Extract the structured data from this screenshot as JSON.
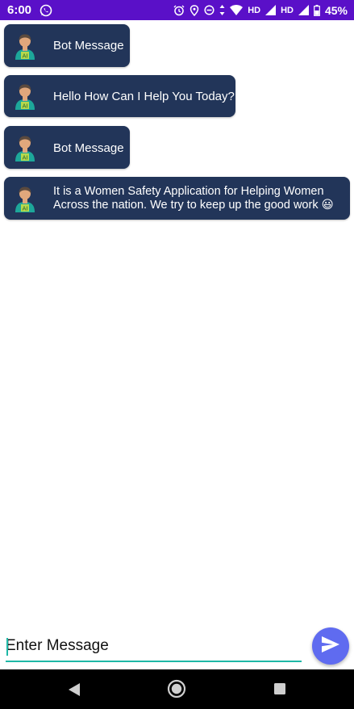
{
  "status_bar": {
    "time": "6:00",
    "network_label_1": "HD",
    "network_label_2": "HD",
    "battery": "45%",
    "icons": [
      "whatsapp-icon",
      "alarm-icon",
      "location-icon",
      "dnd-icon",
      "data-arrows-icon",
      "wifi-icon",
      "signal-icon",
      "signal-icon",
      "battery-icon"
    ],
    "bg_color": "#5a10c8"
  },
  "chat": {
    "bubble_color": "#223559",
    "messages": [
      {
        "sender": "bot",
        "text": "Bot Message"
      },
      {
        "sender": "bot",
        "text": "Hello How Can I Help You Today?"
      },
      {
        "sender": "bot",
        "text": "Bot Message"
      },
      {
        "sender": "bot",
        "text": "It is a Women Safety Application for Helping Women\nAcross the nation. We try to keep up the good work 😃"
      }
    ]
  },
  "composer": {
    "placeholder": "Enter Message",
    "value": "",
    "send_icon": "send-icon",
    "accent_color": "#1fb8a6",
    "send_color": "#5f6bf0"
  },
  "nav": {
    "icons": [
      "back-icon",
      "home-icon",
      "recents-icon"
    ]
  }
}
